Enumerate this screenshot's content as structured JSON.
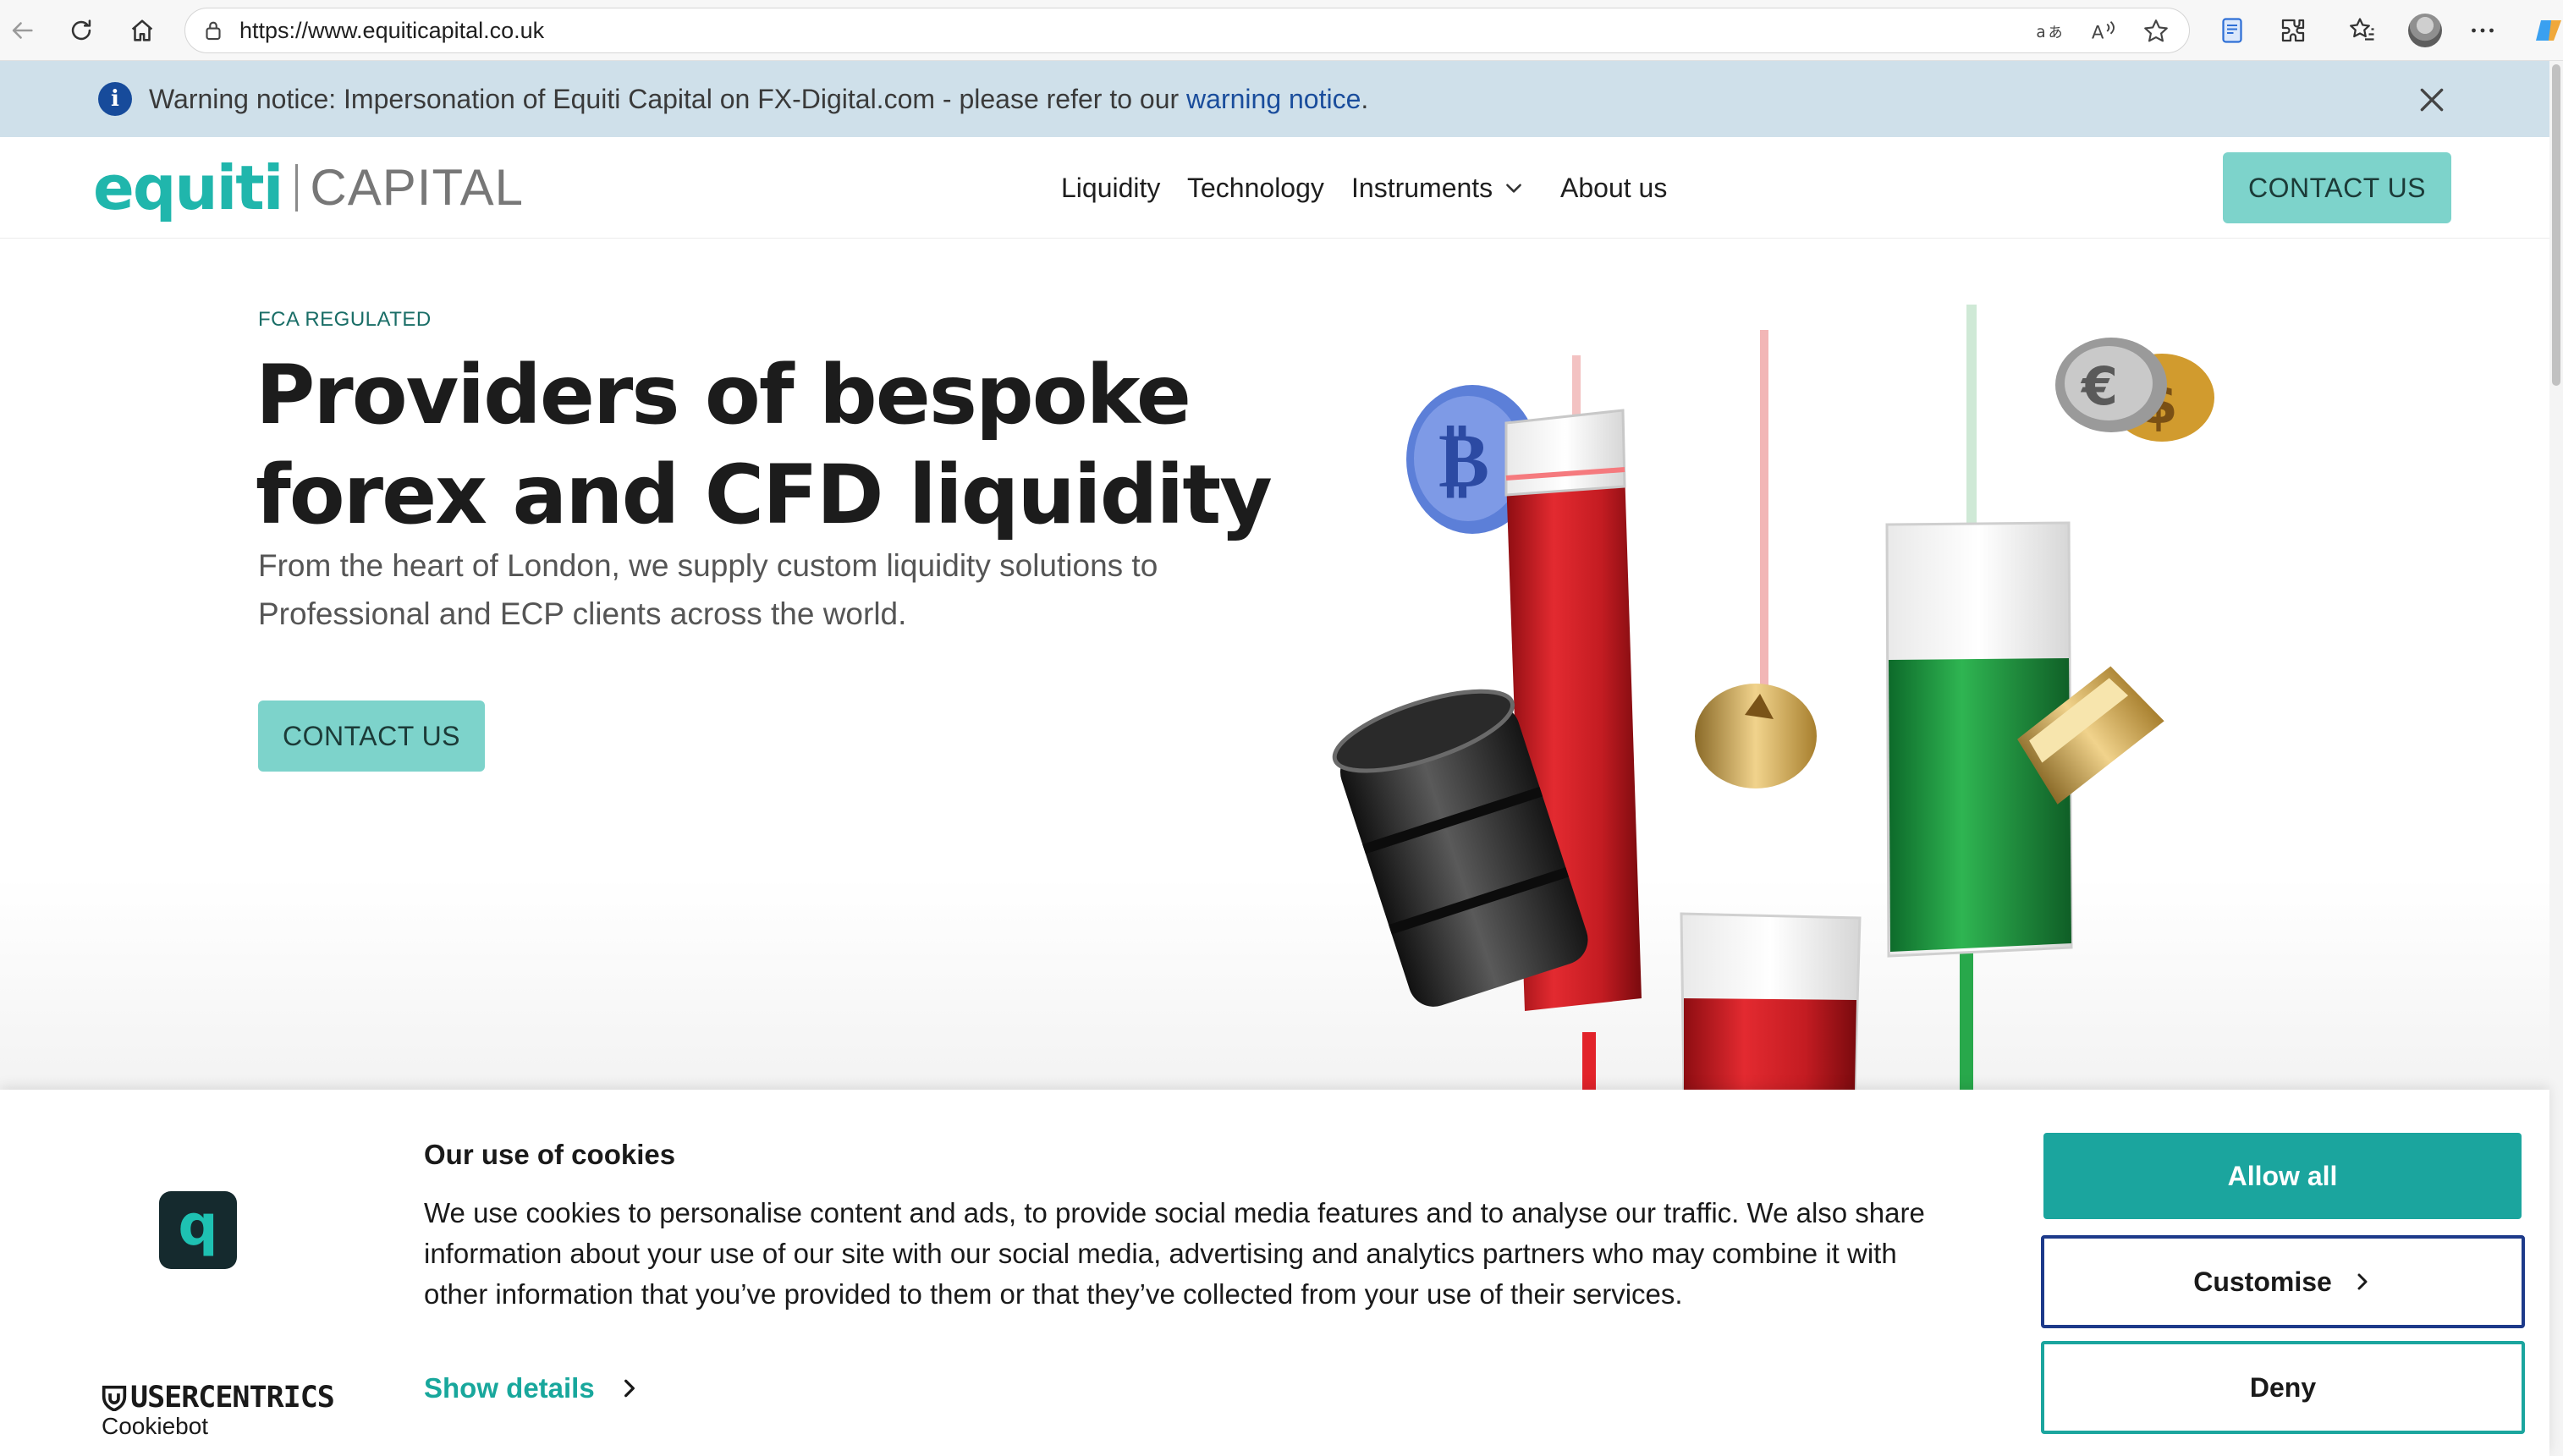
{
  "browser": {
    "url": "https://www.equiticapital.co.uk",
    "icons": [
      "back-icon",
      "refresh-icon",
      "home-icon",
      "lock-icon",
      "translate-icon",
      "read-aloud-icon",
      "favorite-star-icon",
      "reading-view-icon",
      "extensions-icon",
      "favorites-icon",
      "profile-avatar",
      "more-icon"
    ]
  },
  "warning": {
    "text": "Warning notice: Impersonation of Equiti Capital on FX-Digital.com - please refer to our ",
    "link": "warning notice",
    "end": "."
  },
  "header": {
    "brand": "equiti",
    "brand_suffix": "CAPITAL",
    "nav": [
      "Liquidity",
      "Technology",
      "Instruments",
      "About us"
    ],
    "cta": "CONTACT US"
  },
  "hero": {
    "eyebrow": "FCA REGULATED",
    "headline_line1": "Providers of bespoke",
    "headline_line2": "forex and CFD liquidity",
    "subline": "From the heart of London, we supply custom liquidity solutions to Professional and ECP clients across the world.",
    "cta": "CONTACT US"
  },
  "cookie": {
    "title": "Our use of cookies",
    "body": "We use cookies to personalise content and ads, to provide social media features and to analyse our traffic. We also share information about your use of our site with our social media, advertising and analytics partners who may combine it with other information that you’ve provided to them or that they’ve collected from your use of their services.",
    "show_details": "Show details",
    "allow_all": "Allow all",
    "customise": "Customise",
    "deny": "Deny",
    "provider": "USERCENTRICS",
    "provider_sub": "Cookiebot"
  },
  "colors": {
    "brand_teal": "#20b6ac",
    "cta_teal": "#7dd3cb",
    "allow_teal": "#1ba59e",
    "link_blue": "#1a4d9c",
    "banner_bg": "#cfe0ea"
  }
}
